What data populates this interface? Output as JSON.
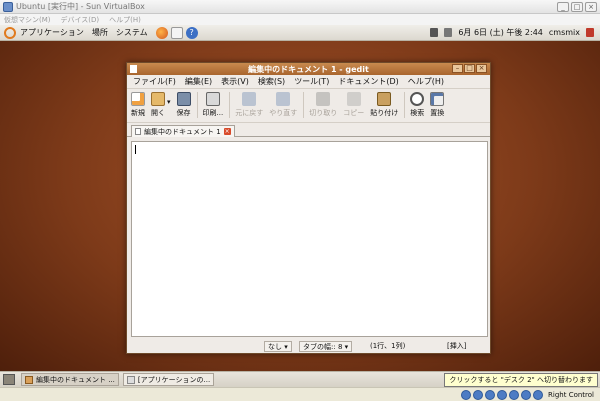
{
  "vbox": {
    "title": "Ubuntu [実行中] - Sun VirtualBox",
    "menu": [
      "仮想マシン(M)",
      "デバイス(D)",
      "ヘルプ(H)"
    ],
    "window_buttons": [
      "_",
      "□",
      "×"
    ]
  },
  "top_panel": {
    "menus": [
      "アプリケーション",
      "場所",
      "システム"
    ],
    "clock": "6月 6日 (土) 午後 2:44",
    "user": "cmsmix"
  },
  "gedit": {
    "title": "編集中のドキュメント 1 - gedit",
    "menu": [
      "ファイル(F)",
      "編集(E)",
      "表示(V)",
      "検索(S)",
      "ツール(T)",
      "ドキュメント(D)",
      "ヘルプ(H)"
    ],
    "toolbar": {
      "new": "新規",
      "open": "開く",
      "save": "保存",
      "print": "印刷...",
      "undo": "元に戻す",
      "redo": "やり直す",
      "cut": "切り取り",
      "copy": "コピー",
      "paste": "貼り付け",
      "find": "検索",
      "replace": "置換"
    },
    "tab_label": "編集中のドキュメント 1",
    "status": {
      "language": "なし",
      "tab_width": "タブの幅:: 8",
      "position": "(1行、1列)",
      "mode": "[挿入]"
    }
  },
  "bottom_panel": {
    "tasks": [
      "編集中のドキュメント ...",
      "[アプリケーションの..."
    ],
    "tooltip": "クリックすると \"デスク 2\" へ切り替わります"
  },
  "host_status": {
    "hostkey": "Right Control"
  },
  "colors": {
    "ubuntu_orange": "#e07a1e",
    "desktop_brown": "#7d3a19",
    "title_orange": "#b06a30"
  }
}
